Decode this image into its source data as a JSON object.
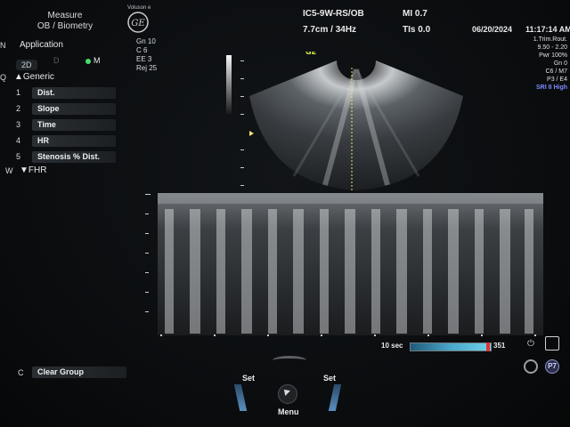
{
  "header": {
    "mode_line1": "Measure",
    "mode_line2": "OB / Biometry",
    "vendor_text": "Voluson e",
    "logo_icon": "ge-logo",
    "probe": "IC5-9W-RS/OB",
    "mi": "MI 0.7",
    "depth": "7.7cm / 34Hz",
    "tis": "TIs 0.0",
    "date": "06/20/2024",
    "time": "11:17:14 AM"
  },
  "params": {
    "gn": "Gn  10",
    "c": "C    6",
    "ee": "EE  3",
    "rej": "Rej  25"
  },
  "menu": {
    "n_key": "N",
    "application": "Application",
    "mode_2d": "2D",
    "mode_d": "D",
    "mode_m": "M",
    "q_key": "Q",
    "generic": "Generic",
    "items": [
      {
        "num": "1",
        "label": "Dist."
      },
      {
        "num": "2",
        "label": "Slope"
      },
      {
        "num": "3",
        "label": "Time"
      },
      {
        "num": "4",
        "label": "HR"
      },
      {
        "num": "5",
        "label": "Stenosis % Dist."
      }
    ],
    "w_key": "W",
    "fhr": "FHR",
    "c_key": "C",
    "clear_group": "Clear Group"
  },
  "right_panel": {
    "line1": "1.Trim.Rout.",
    "line2": "9.50 - 2.20",
    "line3": "Pwr 100%",
    "line4": "Gn   0",
    "line5": "C6 / M7",
    "line6": "P3 / E4",
    "line7": "SRI II High"
  },
  "image": {
    "ge_marker": "GE",
    "sweep": "10 sec",
    "value_351": "351"
  },
  "bottom": {
    "set_left": "Set",
    "set_right": "Set",
    "menu": "Menu"
  },
  "colors": {
    "accent_green": "#44e06a",
    "sri_blue": "#7b8cff",
    "marker_yellow": "#f0e36a"
  }
}
